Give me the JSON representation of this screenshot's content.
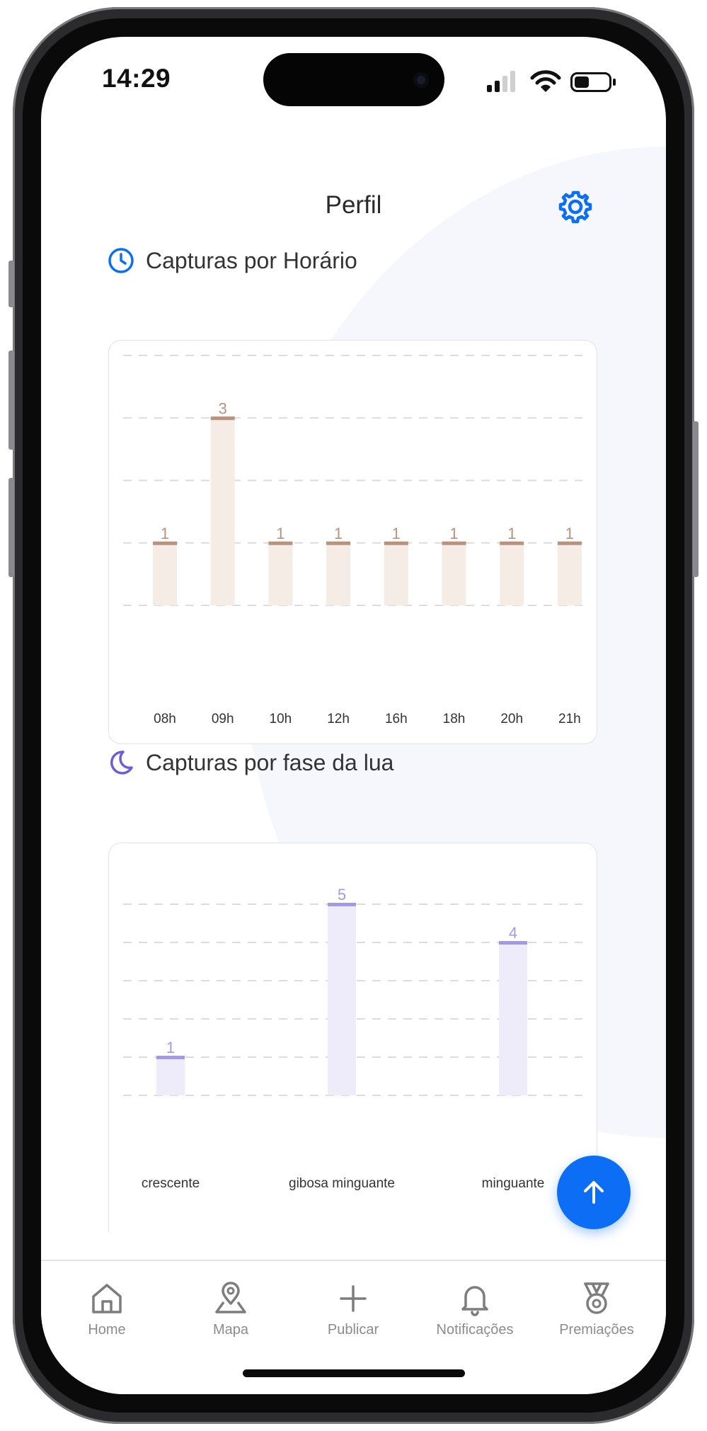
{
  "status_bar": {
    "time": "14:29"
  },
  "header": {
    "title": "Perfil",
    "settings_icon": "gear-icon"
  },
  "colors": {
    "accent": "#0b6ef5",
    "hour_bar_fill": "#f5ece6",
    "hour_bar_cap": "#b8927d",
    "moon_bar_fill": "#eeecfb",
    "moon_bar_cap": "#a29ae4",
    "moon_icon": "#6b5fd6"
  },
  "sections": {
    "hours": {
      "title": "Capturas por Horário",
      "icon": "clock-icon"
    },
    "moon": {
      "title": "Capturas por fase da lua",
      "icon": "moon-icon"
    }
  },
  "chart_data": [
    {
      "type": "bar",
      "title": "Capturas por Horário",
      "categories": [
        "08h",
        "09h",
        "10h",
        "12h",
        "16h",
        "18h",
        "20h",
        "21h"
      ],
      "values": [
        1,
        3,
        1,
        1,
        1,
        1,
        1,
        1
      ],
      "ylim": [
        0,
        4
      ],
      "grid": true
    },
    {
      "type": "bar",
      "title": "Capturas por fase da lua",
      "categories": [
        "crescente",
        "gibosa minguante",
        "minguante"
      ],
      "values": [
        1,
        5,
        4
      ],
      "ylim": [
        0,
        5
      ],
      "grid": true
    }
  ],
  "nav": {
    "items": [
      {
        "label": "Home",
        "icon": "home-icon"
      },
      {
        "label": "Mapa",
        "icon": "map-pin-icon"
      },
      {
        "label": "Publicar",
        "icon": "plus-icon"
      },
      {
        "label": "Notificações",
        "icon": "bell-icon"
      },
      {
        "label": "Premiações",
        "icon": "medal-icon"
      }
    ]
  },
  "fab_icon": "arrow-up-icon"
}
